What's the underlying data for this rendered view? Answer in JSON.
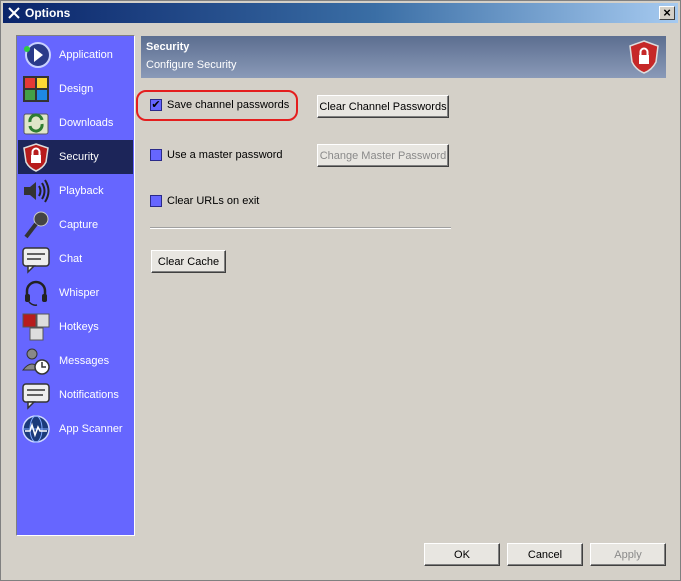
{
  "window": {
    "title": "Options",
    "close_glyph": "×"
  },
  "sidebar": {
    "items": [
      {
        "label": "Application",
        "icon": "application-icon",
        "selected": false
      },
      {
        "label": "Design",
        "icon": "design-icon",
        "selected": false
      },
      {
        "label": "Downloads",
        "icon": "downloads-icon",
        "selected": false
      },
      {
        "label": "Security",
        "icon": "security-lock-icon",
        "selected": true
      },
      {
        "label": "Playback",
        "icon": "speaker-icon",
        "selected": false
      },
      {
        "label": "Capture",
        "icon": "microphone-icon",
        "selected": false
      },
      {
        "label": "Chat",
        "icon": "chat-bubble-icon",
        "selected": false
      },
      {
        "label": "Whisper",
        "icon": "headset-icon",
        "selected": false
      },
      {
        "label": "Hotkeys",
        "icon": "hotkeys-icon",
        "selected": false
      },
      {
        "label": "Messages",
        "icon": "user-clock-icon",
        "selected": false
      },
      {
        "label": "Notifications",
        "icon": "notification-bubble-icon",
        "selected": false
      },
      {
        "label": "App Scanner",
        "icon": "globe-icon",
        "selected": false
      }
    ]
  },
  "header": {
    "title": "Security",
    "subtitle": "Configure Security",
    "icon": "shield-lock-icon"
  },
  "settings": {
    "save_channel_passwords": {
      "label": "Save channel passwords",
      "checked": true
    },
    "use_master_password": {
      "label": "Use a master password",
      "checked": false
    },
    "clear_urls": {
      "label": "Clear URLs on exit",
      "checked": false
    },
    "clear_channel_passwords_button": "Clear Channel Passwords",
    "change_master_password_button": "Change Master Password",
    "clear_cache_button": "Clear Cache"
  },
  "footer": {
    "ok": "OK",
    "cancel": "Cancel",
    "apply": "Apply"
  },
  "colors": {
    "sidebar_bg": "#6666ff",
    "sidebar_selected": "#1c2559",
    "highlight": "#e41e1e"
  }
}
